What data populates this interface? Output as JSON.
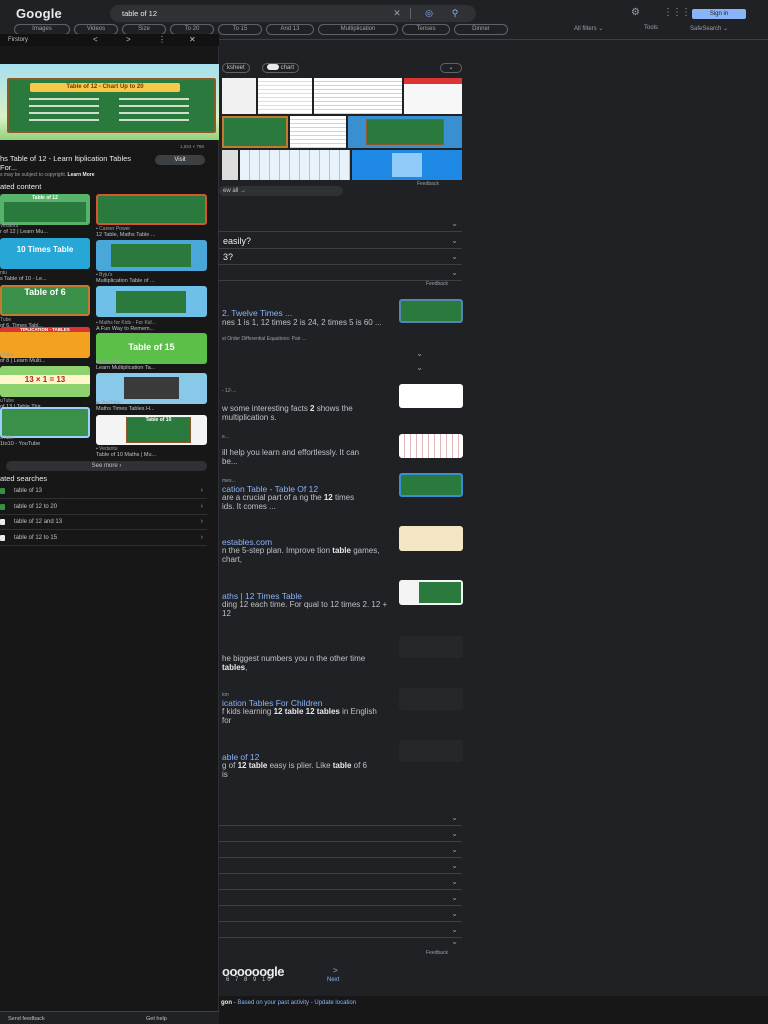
{
  "header": {
    "logo": "Google",
    "query": "table of 12",
    "signin": "Sign in",
    "filters": [
      "Images",
      "Videos",
      "Size",
      "To 20",
      "To 15",
      "And 13",
      "Multiplication",
      "Tenses",
      "Dinner"
    ],
    "all_filters": "All filters",
    "tools": "Tools",
    "safesearch": "SafeSearch"
  },
  "side_panel": {
    "source": "Firstory",
    "controls": [
      "<",
      ">",
      "⋮",
      "✕"
    ],
    "board_title": "Table of 12 - Chart Up to 20",
    "image_size": "1,024 × 768",
    "title": "hs Table of 12 - Learn ltiplication Tables For...",
    "visit": "Visit",
    "copyright": "s may be subject to copyright.",
    "learn_more": "Learn More",
    "related_heading": "ated content",
    "related": [
      {
        "thumb": "Table of 12",
        "source": "Vedantu",
        "caption": "r of 12 | Learn Mu..."
      },
      {
        "thumb": "",
        "source": "Career Power",
        "caption": "12 Table, Maths Table ..."
      },
      {
        "thumb": "10 Times Table",
        "source": "ntu",
        "caption": "s Table of 10 - Le..."
      },
      {
        "thumb": "",
        "source": "Byju's",
        "caption": "Multiplication Table of ..."
      },
      {
        "thumb": "Table of 6",
        "source": "Tube",
        "caption": "of 6, Times Tabl..."
      },
      {
        "thumb": "",
        "source": "Maths for Kids - For Kid...",
        "caption": "A Fun Way to Remem..."
      },
      {
        "thumb": "TIPLICATION - TABLES",
        "source": "uTube",
        "caption": "of 8 | Learn Multi..."
      },
      {
        "thumb": "Table of 15",
        "source": "YouTube",
        "caption": "Learn Multiplication Ta..."
      },
      {
        "thumb": "13 × 1 = 13",
        "source": "uTube",
        "caption": "of 13 | Table Thir..."
      },
      {
        "thumb": "",
        "source": "YouTube",
        "caption": "Maths Times Tables H..."
      },
      {
        "thumb": "",
        "source": "uTube",
        "caption": "1to10 - YouTube"
      },
      {
        "thumb": "Table of 10",
        "source": "Vedantu",
        "caption": "Table of 10 Maths | Mu..."
      }
    ],
    "see_more": "See more",
    "related_searches_heading": "ated searches",
    "related_searches": [
      "table of 13",
      "table of 12 to 20",
      "table of 12 and 13",
      "table of 12 to 15"
    ],
    "send_feedback": "Send feedback",
    "get_help": "Get help"
  },
  "main": {
    "image_chips": [
      "ksheet",
      "chart"
    ],
    "image_feedback": "Feedback",
    "view_all": "ew all",
    "paa": [
      "",
      "easily?",
      "3?",
      ""
    ],
    "paa_feedback": "Feedback",
    "results": [
      {
        "link": "2. Twelve Times ...",
        "snippet": "nes 1 is 1, 12 times 2 is 24, 2 times 5 is 60 ...",
        "meta": "st Order Differential Equations: Pair ..."
      },
      {
        "meta": "- 12-...",
        "snippet_pre": "w some interesting facts",
        "bold": "2",
        "snippet_post": " shows the multiplication s."
      },
      {
        "meta": "e...",
        "snippet": "ill help you learn and effortlessly. It can be..."
      },
      {
        "meta": "mes...",
        "link": "cation Table - Table Of 12",
        "snippet_pre": "are a crucial part of a ng the ",
        "bold": "12",
        "snippet_post": " times ids. It comes ..."
      },
      {
        "link": "estables.com",
        "snippet_pre": "n the 5-step plan. Improve tion ",
        "bold": "table",
        "snippet_post": " games, chart,"
      },
      {
        "link": "aths | 12 Times Table",
        "snippet": "ding 12 each time. For qual to 12 times 2. 12 + 12"
      },
      {
        "snippet_pre": "he biggest numbers you n the other time ",
        "bold": "tables",
        "snippet_post": ","
      },
      {
        "meta": "ion",
        "link": "ication Tables For Children",
        "snippet_pre": "f kids learning ",
        "bold": "12 table",
        "snippet_post": " ",
        "bold2": "12 tables",
        "snippet_post2": " in English for"
      },
      {
        "link": "able of 12",
        "snippet_pre": "g of ",
        "bold": "12 table",
        "snippet_post": " easy is plier. Like ",
        "bold2": "table",
        "snippet_post2": " of 6 is"
      }
    ],
    "accordion_rows": 9,
    "bottom_feedback": "Feedback",
    "pager_logo": "oooooogle",
    "pager_numbers": "6 7 8 9 10",
    "pager_next": "Next",
    "location_prefix": "gon",
    "location_links": "Based on your past activity - Update location"
  },
  "colors": {
    "background": "#202124",
    "panel": "#171717",
    "link": "#8ab4f8",
    "board_green": "#2b7a3d",
    "board_title": "#f7c948"
  }
}
